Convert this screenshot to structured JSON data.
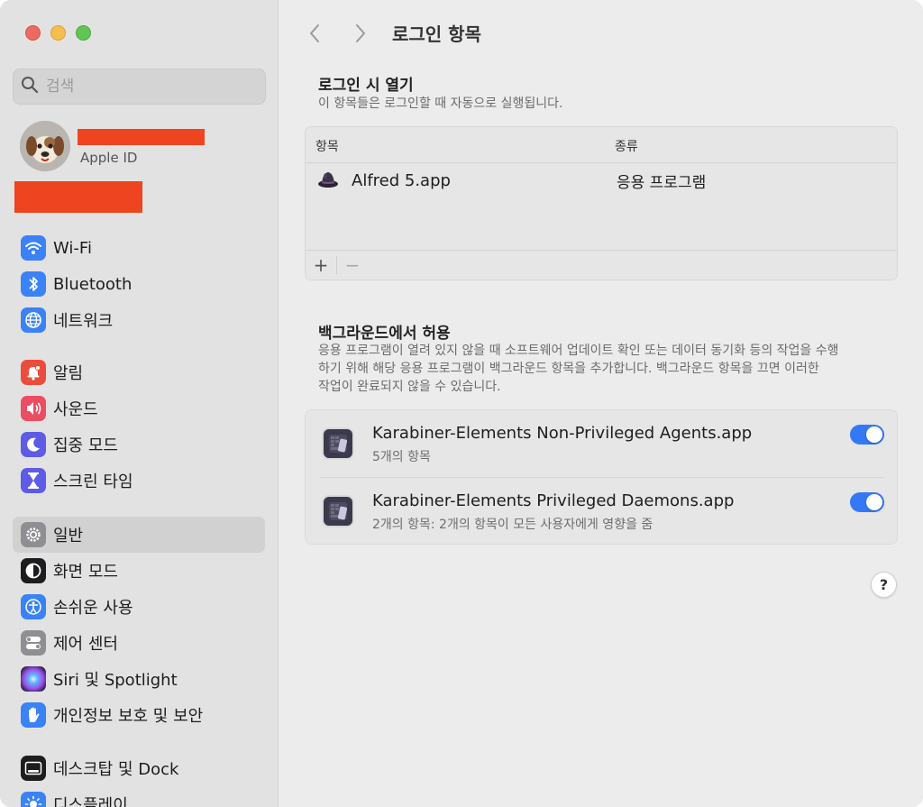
{
  "sidebar": {
    "search_placeholder": "검색",
    "account": {
      "subtitle": "Apple ID"
    },
    "items": [
      {
        "label": "Wi-Fi",
        "icon": "wifi-icon",
        "color": "#3a82f7"
      },
      {
        "label": "Bluetooth",
        "icon": "bluetooth-icon",
        "color": "#3a82f7"
      },
      {
        "label": "네트워크",
        "icon": "globe-icon",
        "color": "#3a82f7"
      },
      {
        "label": "알림",
        "icon": "bell-icon",
        "color": "#eb4d3d"
      },
      {
        "label": "사운드",
        "icon": "speaker-icon",
        "color": "#eb4d61"
      },
      {
        "label": "집중 모드",
        "icon": "moon-icon",
        "color": "#5e5ce6"
      },
      {
        "label": "스크린 타임",
        "icon": "hourglass-icon",
        "color": "#5e5ce6"
      },
      {
        "label": "일반",
        "icon": "gear-icon",
        "color": "#8e8e93",
        "selected": true
      },
      {
        "label": "화면 모드",
        "icon": "appearance-icon",
        "color": "#1d1d1f"
      },
      {
        "label": "손쉬운 사용",
        "icon": "accessibility-icon",
        "color": "#3a82f7"
      },
      {
        "label": "제어 센터",
        "icon": "switches-icon",
        "color": "#8e8e93"
      },
      {
        "label": "Siri 및 Spotlight",
        "icon": "siri-icon",
        "color": "#7b4fe0"
      },
      {
        "label": "개인정보 보호 및 보안",
        "icon": "hand-icon",
        "color": "#3a82f7"
      },
      {
        "label": "데스크탑 및 Dock",
        "icon": "dock-icon",
        "color": "#1d1d1f"
      },
      {
        "label": "디스플레이",
        "icon": "sun-icon",
        "color": "#3a82f7"
      }
    ]
  },
  "toolbar": {
    "title": "로그인 항목"
  },
  "login_section": {
    "title": "로그인 시 열기",
    "description": "이 항목들은 로그인할 때 자동으로 실행됩니다.",
    "columns": {
      "item": "항목",
      "kind": "종류"
    },
    "rows": [
      {
        "name": "Alfred 5.app",
        "kind": "응용 프로그램",
        "icon": "alfred-hat-icon"
      }
    ],
    "add_label": "+",
    "remove_label": "−"
  },
  "background_section": {
    "title": "백그라운드에서 허용",
    "description_lines": [
      "응용 프로그램이 열려 있지 않을 때 소프트웨어 업데이트 확인 또는 데이터 동기화 등의 작업을 수행",
      "하기 위해 해당 응용 프로그램이 백그라운드 항목을 추가합니다. 백그라운드 항목을 끄면 이러한",
      "작업이 완료되지 않을 수 있습니다."
    ],
    "items": [
      {
        "name": "Karabiner-Elements Non-Privileged Agents.app",
        "subtitle": "5개의 항목",
        "enabled": true
      },
      {
        "name": "Karabiner-Elements Privileged Daemons.app",
        "subtitle": "2개의 항목: 2개의 항목이 모든 사용자에게 영향을 줌",
        "enabled": true
      }
    ]
  },
  "help_label": "?",
  "colors": {
    "accent": "#3478f6",
    "redaction": "#ee4420"
  }
}
